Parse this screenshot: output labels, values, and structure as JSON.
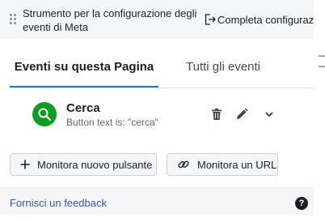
{
  "header": {
    "title": "Strumento per la configurazione degli eventi di Meta",
    "complete_label": "Completa configurazio"
  },
  "tabs": [
    {
      "label": "Eventi su questa Pagina",
      "active": true
    },
    {
      "label": "Tutti gli eventi",
      "active": false
    }
  ],
  "events": [
    {
      "name": "Cerca",
      "description": "Button text is: \"cerca\"",
      "icon": "search-icon",
      "color": "#0e9c22"
    }
  ],
  "actions": {
    "track_button": "Monitora nuovo pulsante",
    "track_url": "Monitora un URL"
  },
  "footer": {
    "feedback": "Fornisci un feedback",
    "help_icon": "?"
  },
  "colors": {
    "accent": "#1877f2",
    "link": "#385898"
  }
}
